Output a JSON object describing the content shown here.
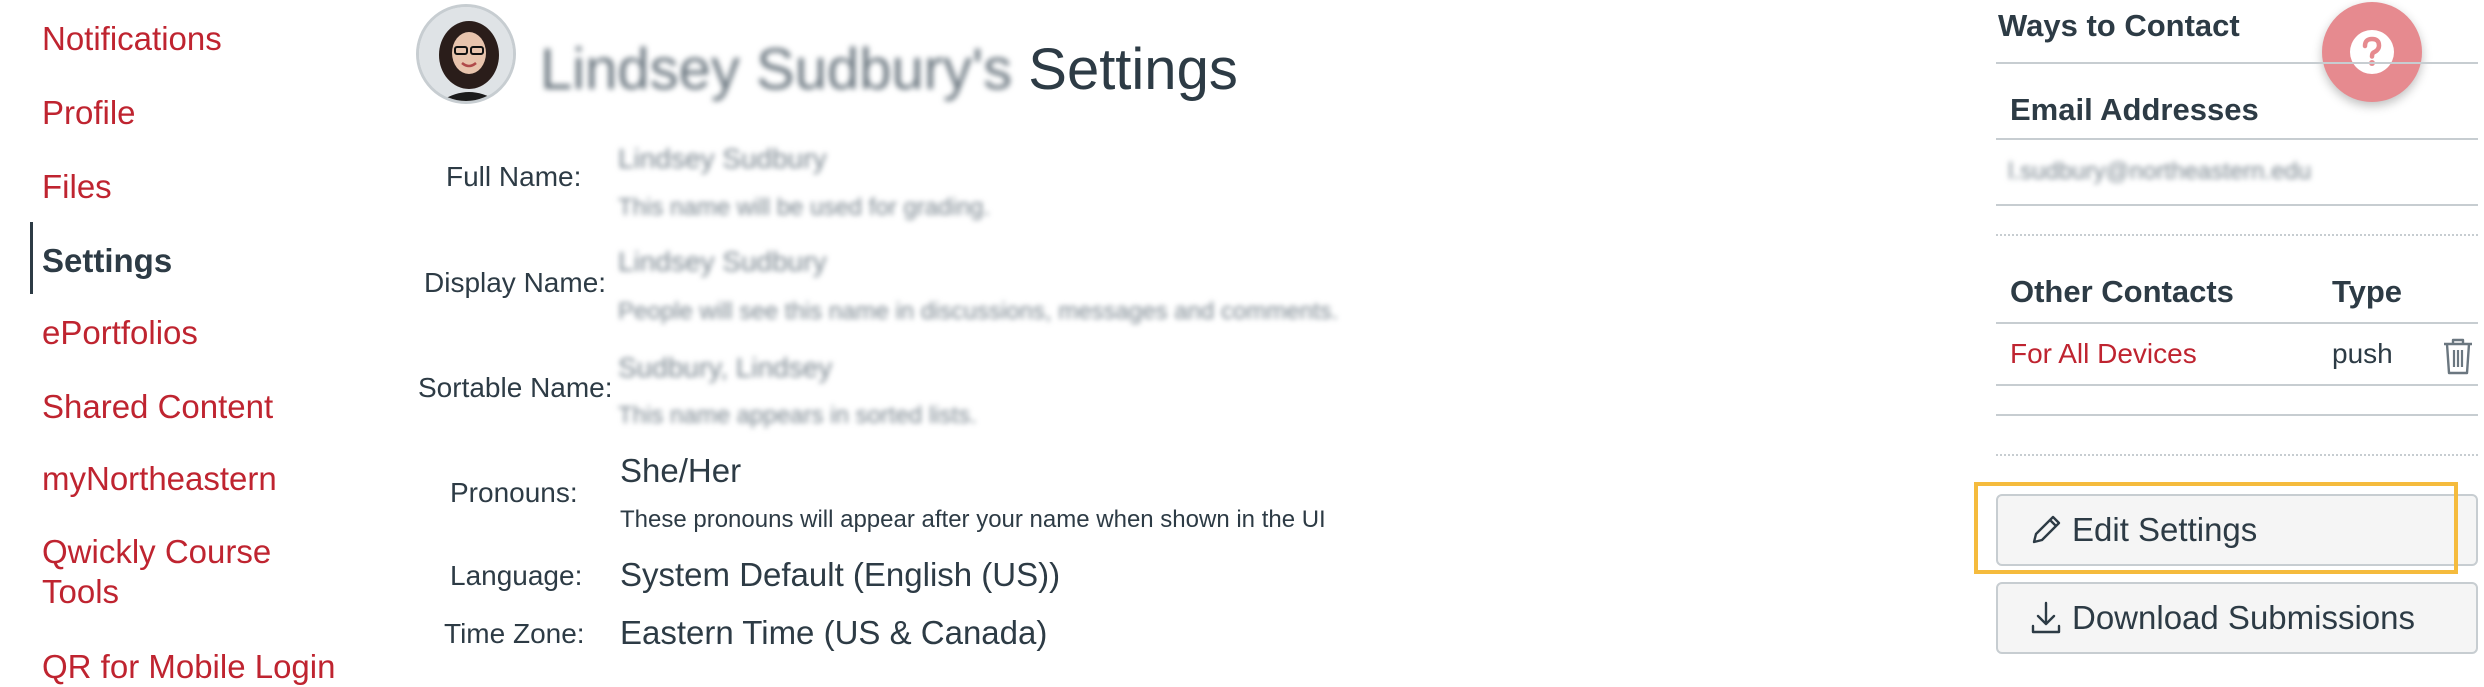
{
  "nav": {
    "items": [
      {
        "label": "Notifications",
        "active": false
      },
      {
        "label": "Profile",
        "active": false
      },
      {
        "label": "Files",
        "active": false
      },
      {
        "label": "Settings",
        "active": true
      },
      {
        "label": "ePortfolios",
        "active": false
      },
      {
        "label": "Shared Content",
        "active": false
      },
      {
        "label": "myNortheastern",
        "active": false
      },
      {
        "label": "Qwickly Course\nTools",
        "active": false
      },
      {
        "label": "QR for Mobile Login",
        "active": false
      }
    ]
  },
  "header": {
    "user_name": "Lindsey Sudbury's",
    "title_suffix": " Settings"
  },
  "profile": {
    "full_name_label": "Full Name:",
    "full_name_value": "Lindsey Sudbury",
    "full_name_hint": "This name will be used for grading.",
    "display_name_label": "Display Name:",
    "display_name_value": "Lindsey Sudbury",
    "display_name_hint": "People will see this name in discussions, messages and comments.",
    "sortable_name_label": "Sortable Name:",
    "sortable_name_value": "Sudbury, Lindsey",
    "sortable_name_hint": "This name appears in sorted lists.",
    "pronouns_label": "Pronouns:",
    "pronouns_value": "She/Her",
    "pronouns_hint": "These pronouns will appear after your name when shown in the UI",
    "language_label": "Language:",
    "language_value": "System Default (English (US))",
    "timezone_label": "Time Zone:",
    "timezone_value": "Eastern Time (US & Canada)"
  },
  "contact": {
    "heading": "Ways to Contact",
    "email_heading": "Email Addresses",
    "email_value": "l.sudbury@northeastern.edu",
    "other_heading": "Other Contacts",
    "type_heading": "Type",
    "rows": [
      {
        "name": "For All Devices",
        "type": "push"
      }
    ]
  },
  "buttons": {
    "edit_settings": "Edit Settings",
    "download_submissions": "Download Submissions"
  },
  "icons": {
    "help": "question-mark-icon",
    "delete": "trash-icon",
    "edit": "pencil-icon",
    "download": "download-icon"
  },
  "colors": {
    "link": "#bf2430",
    "text": "#2d3b45",
    "focus": "#f5bb3d",
    "help_button": "#e68a8f"
  }
}
